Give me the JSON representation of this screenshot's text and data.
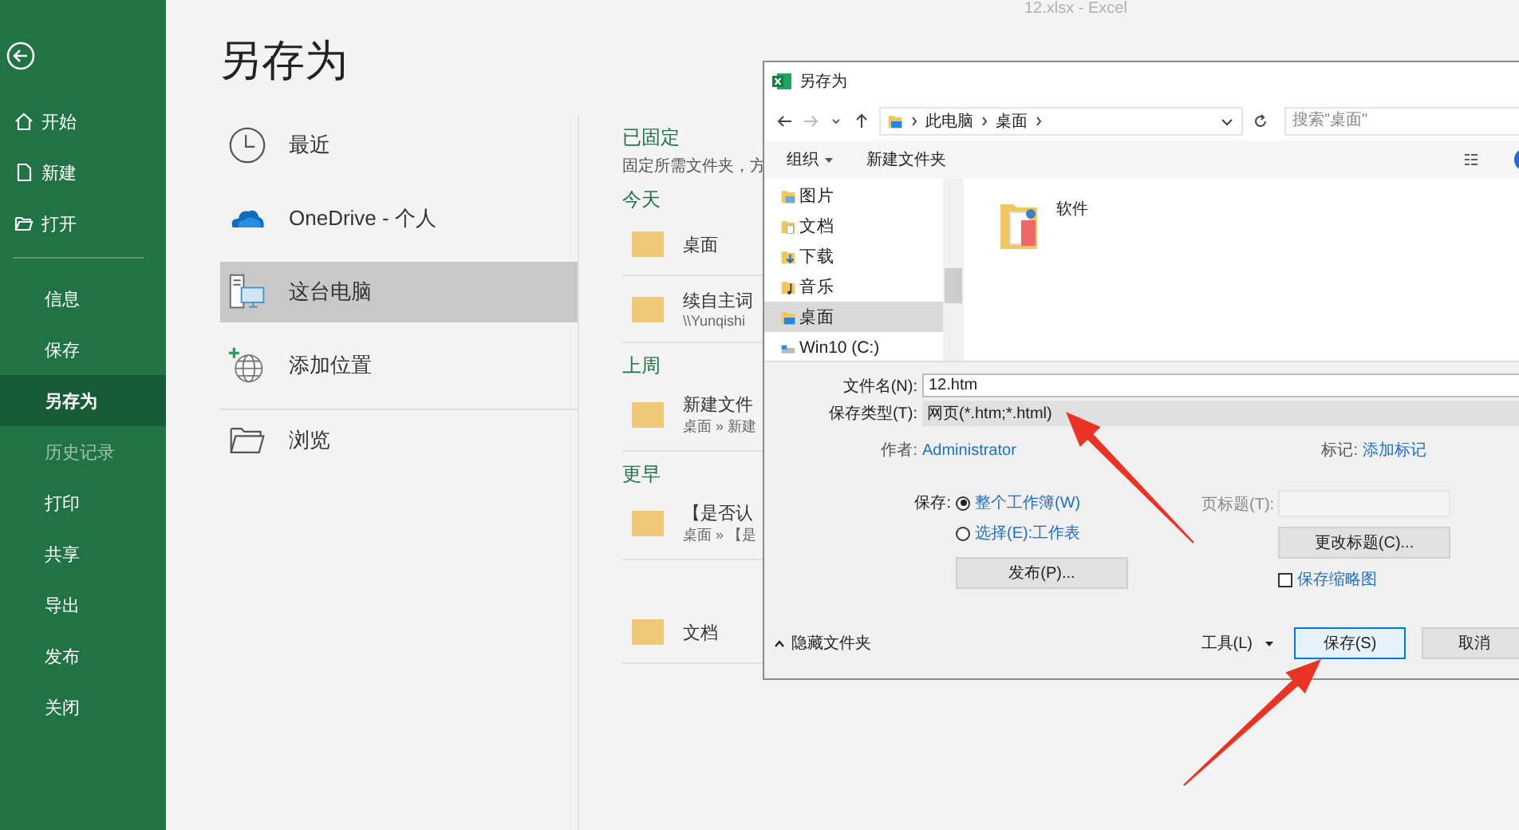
{
  "app_title": "12.xlsx  -  Excel",
  "sidebar": {
    "items": [
      {
        "label": "开始",
        "kind": "home",
        "selected": false,
        "disabled": false
      },
      {
        "label": "新建",
        "kind": "new",
        "selected": false,
        "disabled": false
      },
      {
        "label": "打开",
        "kind": "open",
        "selected": false,
        "disabled": false
      },
      {
        "label": "信息",
        "kind": "plain",
        "selected": false,
        "disabled": false
      },
      {
        "label": "保存",
        "kind": "plain",
        "selected": false,
        "disabled": false
      },
      {
        "label": "另存为",
        "kind": "plain",
        "selected": true,
        "disabled": false
      },
      {
        "label": "历史记录",
        "kind": "plain",
        "selected": false,
        "disabled": true
      },
      {
        "label": "打印",
        "kind": "plain",
        "selected": false,
        "disabled": false
      },
      {
        "label": "共享",
        "kind": "plain",
        "selected": false,
        "disabled": false
      },
      {
        "label": "导出",
        "kind": "plain",
        "selected": false,
        "disabled": false
      },
      {
        "label": "发布",
        "kind": "plain",
        "selected": false,
        "disabled": false
      },
      {
        "label": "关闭",
        "kind": "plain",
        "selected": false,
        "disabled": false
      }
    ]
  },
  "page_title": "另存为",
  "locations": [
    {
      "label": "最近",
      "kind": "clock",
      "selected": false
    },
    {
      "label": "OneDrive - 个人",
      "kind": "cloud",
      "selected": false
    },
    {
      "label": "这台电脑",
      "kind": "pc",
      "selected": true
    },
    {
      "label": "添加位置",
      "kind": "globe",
      "selected": false
    },
    {
      "label": "浏览",
      "kind": "folder",
      "selected": false
    }
  ],
  "recent": {
    "sections": [
      {
        "heading": "已固定",
        "note": "固定所需文件夹，方"
      },
      {
        "heading": "今天",
        "items": [
          {
            "name": "桌面"
          },
          {
            "name": "续自主词",
            "path": "\\\\Yunqishi"
          }
        ]
      },
      {
        "heading": "上周",
        "items": [
          {
            "name": "新建文件",
            "path": "桌面 » 新建"
          }
        ]
      },
      {
        "heading": "更早",
        "items": [
          {
            "name": "【是否认",
            "path": "桌面 » 【是"
          },
          {
            "name": "文档"
          }
        ]
      }
    ]
  },
  "dialog": {
    "title": "另存为",
    "breadcrumb": [
      "此电脑",
      "桌面"
    ],
    "search": {
      "placeholder": "搜索\"桌面\""
    },
    "toolbar": {
      "organize": "组织",
      "new_folder": "新建文件夹"
    },
    "tree": [
      {
        "label": "图片",
        "kind": "pictures",
        "selected": false
      },
      {
        "label": "文档",
        "kind": "documents",
        "selected": false
      },
      {
        "label": "下载",
        "kind": "downloads",
        "selected": false
      },
      {
        "label": "音乐",
        "kind": "music",
        "selected": false
      },
      {
        "label": "桌面",
        "kind": "desktop",
        "selected": true
      },
      {
        "label": "Win10 (C:)",
        "kind": "drive",
        "selected": false
      }
    ],
    "files": [
      {
        "name": "软件"
      }
    ],
    "filename": {
      "label": "文件名(N):",
      "value": "12.htm"
    },
    "filetype": {
      "label": "保存类型(T):",
      "value": "网页(*.htm;*.html)"
    },
    "author": {
      "label": "作者:",
      "value": "Administrator"
    },
    "tags": {
      "label": "标记:",
      "value": "添加标记"
    },
    "scope": {
      "label": "保存:",
      "options": [
        {
          "label": "整个工作簿(W)",
          "selected": true
        },
        {
          "label": "选择(E):工作表",
          "selected": false
        }
      ]
    },
    "publish_button": "发布(P)...",
    "page_title": {
      "label": "页标题(T):"
    },
    "change_title_button": "更改标题(C)...",
    "thumbnail": {
      "label": "保存缩略图",
      "checked": false
    },
    "hide_folders": "隐藏文件夹",
    "tools": "工具(L)",
    "save_button": "保存(S)",
    "cancel_button": "取消"
  }
}
